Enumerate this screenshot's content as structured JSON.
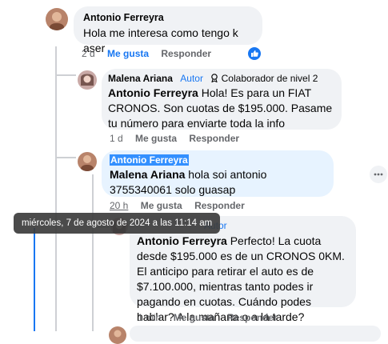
{
  "comments": [
    {
      "author": "Antonio Ferreyra",
      "text": "Hola me interesa como tengo k aser",
      "time": "2 d",
      "like_label": "Me gusta",
      "reply_label": "Responder"
    },
    {
      "author": "Malena Ariana",
      "author_badge": "Autor",
      "level_badge": "Colaborador de nivel 2",
      "mention": "Antonio Ferreyra",
      "text": " Hola! Es para un FIAT CRONOS. Son cuotas de $195.000. Pasame tu número para enviarte toda la info",
      "time": "1 d",
      "like_label": "Me gusta",
      "reply_label": "Responder"
    },
    {
      "author": "Antonio Ferreyra",
      "mention": "Malena Ariana",
      "text": " hola soi antonio 3755340061 solo guasap",
      "time": "20 h",
      "like_label": "Me gusta",
      "reply_label": "Responder"
    },
    {
      "author_badge": "Autor",
      "mention": "Antonio Ferreyra",
      "text": " Perfecto! La cuota desde $195.000 es de un CRONOS 0KM. El anticipo para retirar el auto es de $7.100.000, mientras tanto podes ir pagando en cuotas. Cuándo podes hablar? A la mañana o a la tarde?",
      "time": "1 min",
      "like_label": "Me gusta",
      "reply_label": "Responder"
    }
  ],
  "tooltip": "miércoles, 7 de agosto de 2024 a las 11:14 am",
  "colors": {
    "accent": "#1877f2",
    "bubble": "#f0f2f5",
    "highlight_bubble": "#e7f3ff",
    "meta_text": "#65676b"
  }
}
